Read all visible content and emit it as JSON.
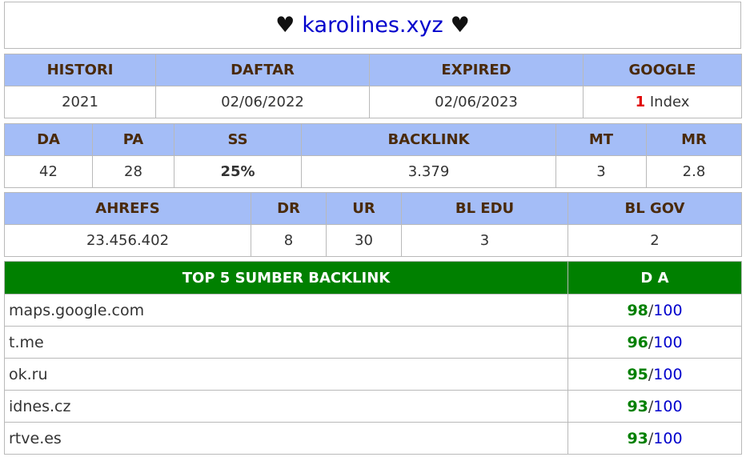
{
  "title": {
    "heart_left": "♥",
    "domain": "karolines.xyz",
    "heart_right": "♥"
  },
  "table1": {
    "headers": [
      "HISTORI",
      "DAFTAR",
      "EXPIRED",
      "GOOGLE"
    ],
    "values": {
      "histori": "2021",
      "daftar": "02/06/2022",
      "expired": "02/06/2023",
      "google_count": "1",
      "google_label": " Index"
    }
  },
  "table2": {
    "headers": [
      "DA",
      "PA",
      "SS",
      "BACKLINK",
      "MT",
      "MR"
    ],
    "values": [
      "42",
      "28",
      "25%",
      "3.379",
      "3",
      "2.8"
    ]
  },
  "table3": {
    "headers": [
      "AHREFS",
      "DR",
      "UR",
      "BL EDU",
      "BL GOV"
    ],
    "values": [
      "23.456.402",
      "8",
      "30",
      "3",
      "2"
    ]
  },
  "top5": {
    "header_left": "TOP 5 SUMBER BACKLINK",
    "header_right": "D A",
    "rows": [
      {
        "site": "maps.google.com",
        "da": "98",
        "max": "100"
      },
      {
        "site": "t.me",
        "da": "96",
        "max": "100"
      },
      {
        "site": "ok.ru",
        "da": "95",
        "max": "100"
      },
      {
        "site": "idnes.cz",
        "da": "93",
        "max": "100"
      },
      {
        "site": "rtve.es",
        "da": "93",
        "max": "100"
      }
    ],
    "separator": "/"
  },
  "colors": {
    "header_bg": "#a4bdf7",
    "top_header_bg": "#008000",
    "domain": "#0000cc",
    "red": "#e00000",
    "cyan": "#1fc6d6",
    "green": "#008000"
  }
}
